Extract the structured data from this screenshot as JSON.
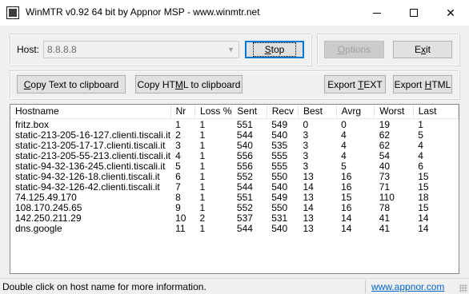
{
  "window": {
    "title": "WinMTR v0.92 64 bit by Appnor MSP - www.winmtr.net",
    "controls": [
      "minimize",
      "maximize",
      "close"
    ]
  },
  "host": {
    "label": "Host:",
    "value": "8.8.8.8"
  },
  "buttons": {
    "stop": "Stop",
    "options": "Options",
    "exit": "Exit",
    "copy_text": "Copy Text to clipboard",
    "copy_html": "Copy HTML to clipboard",
    "export_text": "Export TEXT",
    "export_html": "Export HTML"
  },
  "table": {
    "columns": [
      "Hostname",
      "Nr",
      "Loss %",
      "Sent",
      "Recv",
      "Best",
      "Avrg",
      "Worst",
      "Last"
    ],
    "rows": [
      [
        "fritz.box",
        "1",
        "1",
        "551",
        "549",
        "0",
        "0",
        "19",
        "1"
      ],
      [
        "static-213-205-16-127.clienti.tiscali.it",
        "2",
        "1",
        "544",
        "540",
        "3",
        "4",
        "62",
        "5"
      ],
      [
        "static-213-205-17-17.clienti.tiscali.it",
        "3",
        "1",
        "540",
        "535",
        "3",
        "4",
        "62",
        "4"
      ],
      [
        "static-213-205-55-213.clienti.tiscali.it",
        "4",
        "1",
        "556",
        "555",
        "3",
        "4",
        "54",
        "4"
      ],
      [
        "static-94-32-136-245.clienti.tiscali.it",
        "5",
        "1",
        "556",
        "555",
        "3",
        "5",
        "40",
        "6"
      ],
      [
        "static-94-32-126-18.clienti.tiscali.it",
        "6",
        "1",
        "552",
        "550",
        "13",
        "16",
        "73",
        "15"
      ],
      [
        "static-94-32-126-42.clienti.tiscali.it",
        "7",
        "1",
        "544",
        "540",
        "14",
        "16",
        "71",
        "15"
      ],
      [
        "74.125.49.170",
        "8",
        "1",
        "551",
        "549",
        "13",
        "15",
        "110",
        "18"
      ],
      [
        "108.170.245.65",
        "9",
        "1",
        "552",
        "550",
        "14",
        "16",
        "78",
        "15"
      ],
      [
        "142.250.211.29",
        "10",
        "2",
        "537",
        "531",
        "13",
        "14",
        "41",
        "14"
      ],
      [
        "dns.google",
        "11",
        "1",
        "544",
        "540",
        "13",
        "14",
        "41",
        "14"
      ]
    ]
  },
  "status": {
    "text": "Double click on host name for more information.",
    "link": "www.appnor.com"
  }
}
